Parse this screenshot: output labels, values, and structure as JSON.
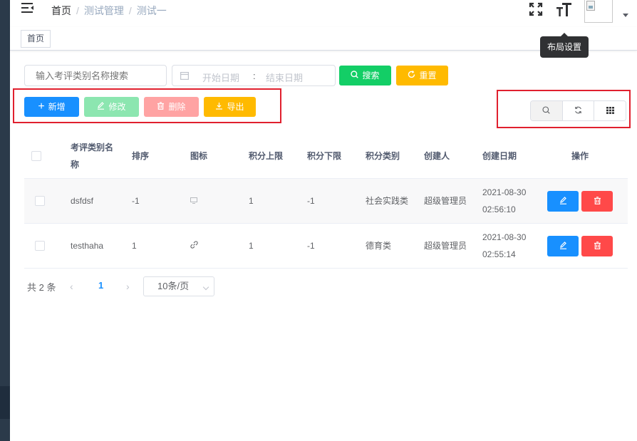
{
  "breadcrumb": {
    "home": "首页",
    "items": [
      "测试管理",
      "测试一"
    ]
  },
  "navbar": {
    "tooltip": "布局设置"
  },
  "tags_view": {
    "tags": [
      "首页"
    ]
  },
  "search": {
    "name_placeholder": "输入考评类别名称搜索",
    "date_start_placeholder": "开始日期",
    "date_separator": ":",
    "date_end_placeholder": "结束日期",
    "search_label": "搜索",
    "reset_label": "重置"
  },
  "toolbar": {
    "add_label": "新增",
    "edit_label": "修改",
    "delete_label": "删除",
    "export_label": "导出"
  },
  "table": {
    "headers": {
      "name": "考评类别名称",
      "sort": "排序",
      "icon": "图标",
      "upper": "积分上限",
      "lower": "积分下限",
      "type": "积分类别",
      "creator": "创建人",
      "created": "创建日期",
      "action": "操作"
    },
    "rows": [
      {
        "name": "dsfdsf",
        "sort": "-1",
        "icon": "monitor-icon",
        "upper": "1",
        "lower": "-1",
        "type": "社会实践类",
        "creator": "超级管理员",
        "date": "2021-08-30",
        "time": "02:56:10"
      },
      {
        "name": "testhaha",
        "sort": "1",
        "icon": "link-icon",
        "upper": "1",
        "lower": "-1",
        "type": "德育类",
        "creator": "超级管理员",
        "date": "2021-08-30",
        "time": "02:55:14"
      }
    ]
  },
  "pagination": {
    "total": "共 2 条",
    "current_page": "1",
    "page_size": "10条/页"
  },
  "colors": {
    "primary": "#1890ff",
    "success": "#13ce66",
    "warning": "#ffba00",
    "danger": "#ff4949",
    "highlight_border": "#e0202e"
  }
}
